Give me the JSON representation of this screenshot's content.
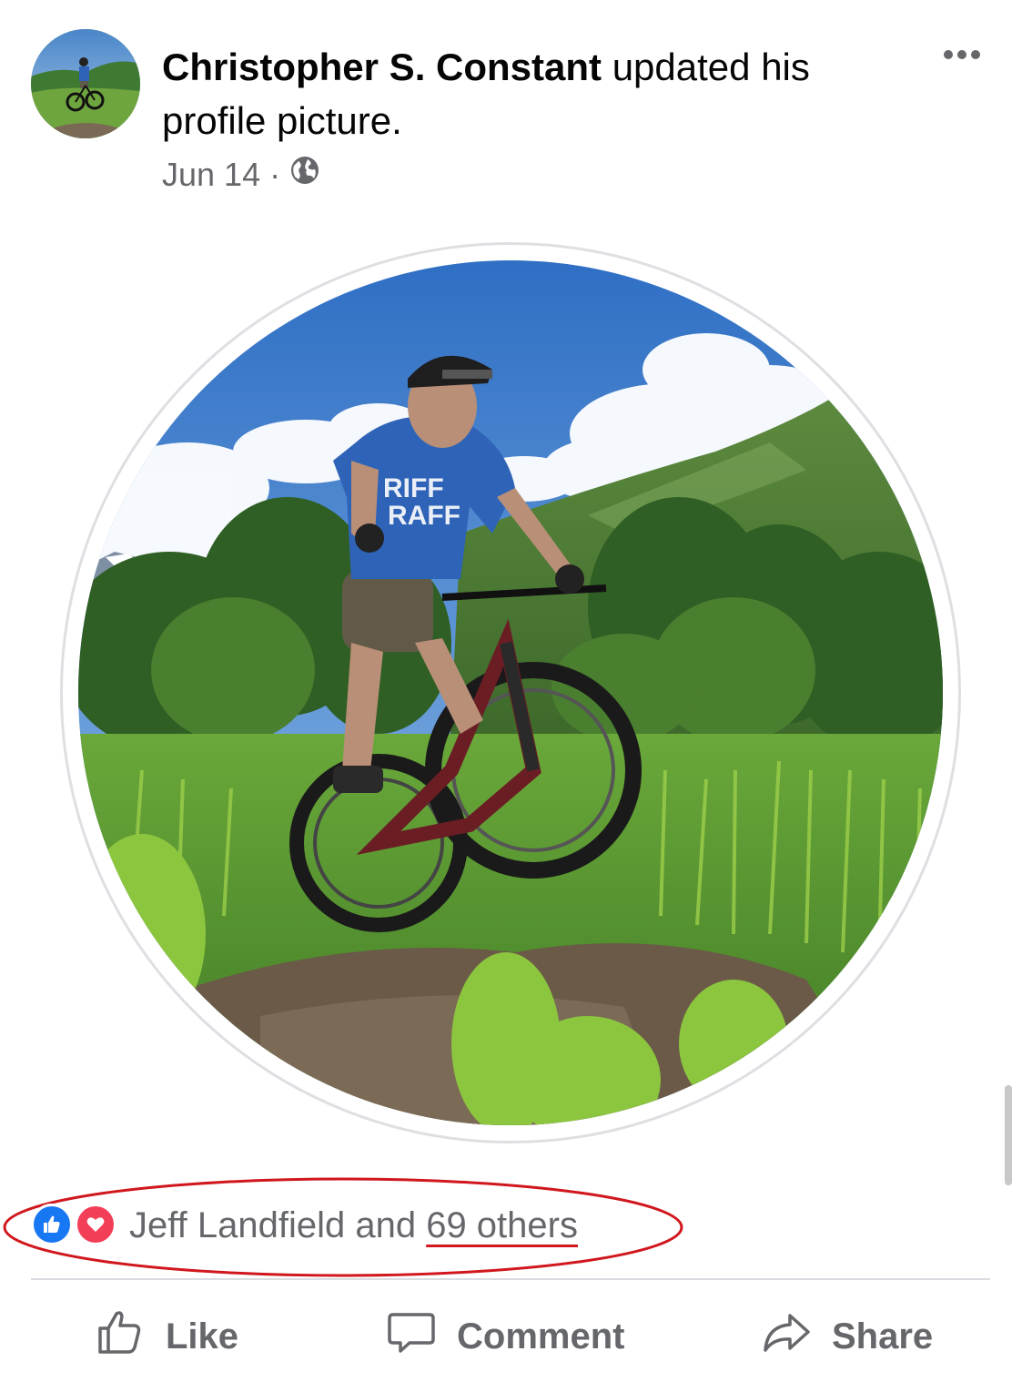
{
  "post": {
    "author": "Christopher S. Constant",
    "action_text": " updated his profile picture.",
    "date": "Jun 14",
    "separator": "·",
    "privacy_icon": "globe-icon",
    "more_icon": "more-horizontal-icon"
  },
  "reactions": {
    "icons": [
      "like-reaction-icon",
      "love-reaction-icon"
    ],
    "name": "Jeff Landfield",
    "joiner": " and ",
    "others": "69 others"
  },
  "actions": {
    "like_label": "Like",
    "comment_label": "Comment",
    "share_label": "Share"
  },
  "colors": {
    "like_blue": "#1877f2",
    "love_red": "#f33e58",
    "secondary_text": "#65676b",
    "annotation_red": "#d0171d"
  }
}
